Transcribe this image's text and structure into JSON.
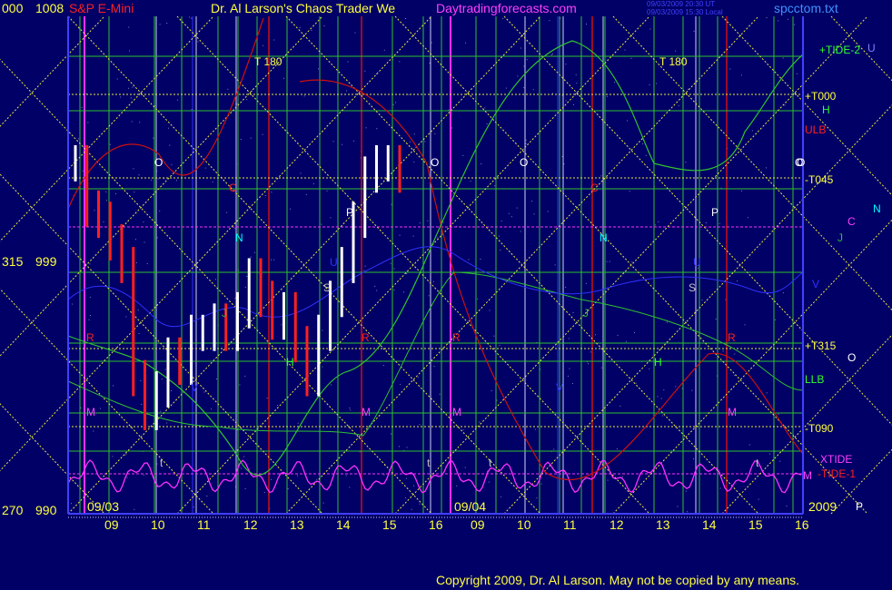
{
  "header": {
    "symbol": "S&P E-Mini",
    "symbol_color": "#ff2020",
    "title": "Dr. Al Larson's Chaos Trader",
    "title_suffix": "We",
    "site": "Daytradingforecasts.com",
    "site_color": "#ff40ff",
    "timestamp_ut": "09/03/2009 20:30 UT",
    "timestamp_local": "09/03/2009 15:30 Local",
    "file": "spcctom.txt"
  },
  "axis_left": [
    {
      "angle": "000",
      "price": "1008"
    },
    {
      "angle": "315",
      "price": "999"
    },
    {
      "angle": "270",
      "price": "990"
    }
  ],
  "day_labels": {
    "first": "09/03",
    "second": "09/04",
    "year": "2009"
  },
  "hour_ticks_day1": [
    "09",
    "10",
    "11",
    "12",
    "13",
    "14",
    "15",
    "16"
  ],
  "hour_ticks_day2": [
    "09",
    "10",
    "11",
    "12",
    "13",
    "14",
    "15",
    "16"
  ],
  "planet_labels": {
    "t180": "T 180",
    "o": "O",
    "c": "C",
    "n": "N",
    "p": "P",
    "u": "U",
    "s": "S",
    "j": "J",
    "h": "H",
    "v": "V",
    "r": "R",
    "m": "M",
    "t": "t"
  },
  "right_labels": [
    {
      "text": "+TIDE-2",
      "color": "#30ff30"
    },
    {
      "text": "U",
      "color": "#8080ff"
    },
    {
      "text": "+T000",
      "color": "#ffff40"
    },
    {
      "text": "H",
      "color": "#30ff30"
    },
    {
      "text": "ULB",
      "color": "#ff2020"
    },
    {
      "text": "O",
      "color": "#ffffff"
    },
    {
      "text": "-T045",
      "color": "#ffff40"
    },
    {
      "text": "N",
      "color": "#00ffff"
    },
    {
      "text": "C",
      "color": "#ff40ff"
    },
    {
      "text": "J",
      "color": "#30c030"
    },
    {
      "text": "V",
      "color": "#3030ff"
    },
    {
      "text": "+T315",
      "color": "#ffff40"
    },
    {
      "text": "O",
      "color": "#ffffff"
    },
    {
      "text": "LLB",
      "color": "#30ff30"
    },
    {
      "text": "-T090",
      "color": "#ffff40"
    },
    {
      "text": "XTIDE",
      "color": "#ff40ff"
    },
    {
      "text": "-TIDE-1",
      "color": "#ff2020"
    },
    {
      "text": "M",
      "color": "#ff40ff"
    },
    {
      "text": "P",
      "color": "#ffffff"
    }
  ],
  "copyright": "Copyright 2009, Dr. Al Larson. May not be copied by any means.",
  "colors": {
    "background": "#000066",
    "grid_yellow": "#e8e840",
    "grid_green": "#30c030",
    "red_line": "#cc1010",
    "magenta": "#ff30ff",
    "white_axis": "#c0c0ff"
  },
  "chart_data": {
    "type": "line",
    "title": "S&P E-Mini",
    "ylim": [
      988,
      1010
    ],
    "y_ticks": [
      1008,
      999,
      990
    ],
    "x_days": [
      "09/03",
      "09/04"
    ],
    "price_bars": {
      "day": "09/03",
      "hours": [
        9.0,
        9.25,
        9.5,
        9.75,
        10.0,
        10.25,
        10.5,
        10.75,
        11.0,
        11.25,
        11.5,
        11.75,
        12.0,
        12.25,
        12.5,
        12.75,
        13.0,
        13.25,
        13.5,
        13.75,
        14.0,
        14.25,
        14.5,
        14.75,
        15.0,
        15.25,
        15.5,
        15.75,
        16.0
      ],
      "close": [
        1003.5,
        1001.5,
        1001.0,
        1000.0,
        999.0,
        994.0,
        992.5,
        993.5,
        995.0,
        994.5,
        996.0,
        996.0,
        996.5,
        996.0,
        997.0,
        998.5,
        997.5,
        996.5,
        997.0,
        995.5,
        994.0,
        996.0,
        997.5,
        999.0,
        1001.0,
        1003.0,
        1003.5,
        1003.5,
        1003.0
      ]
    },
    "series": [
      {
        "name": "+TIDE-2",
        "color": "#30c030"
      },
      {
        "name": "XTIDE",
        "color": "#ff30ff"
      },
      {
        "name": "-TIDE-1",
        "color": "#cc1010"
      },
      {
        "name": "ULB",
        "color": "#cc1010"
      },
      {
        "name": "LLB",
        "color": "#30c030"
      }
    ]
  }
}
